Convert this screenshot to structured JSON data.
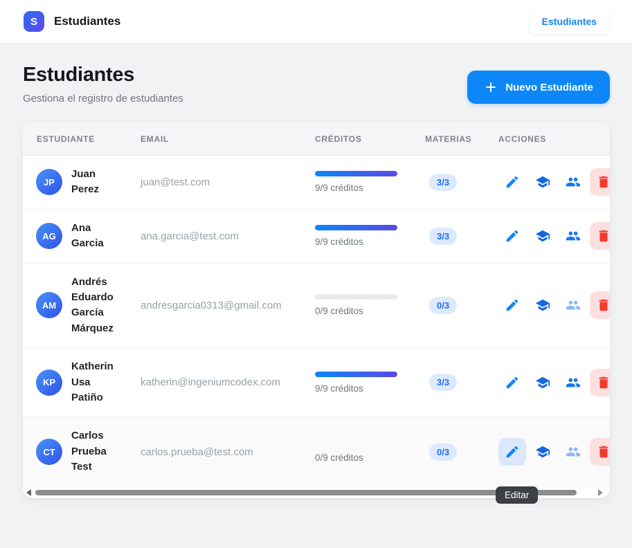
{
  "navbar": {
    "logo_letter": "S",
    "app_title": "Estudiantes",
    "nav_link": "Estudiantes"
  },
  "page_header": {
    "title": "Estudiantes",
    "subtitle": "Gestiona el registro de estudiantes",
    "new_student_button": "Nuevo Estudiante"
  },
  "table": {
    "headers": {
      "student": "ESTUDIANTE",
      "email": "EMAIL",
      "credits": "CRÉDITOS",
      "subjects": "MATERIAS",
      "actions": "ACCIONES"
    },
    "rows": [
      {
        "initials": "JP",
        "name": "Juan Perez",
        "email": "juan@test.com",
        "progress_percent": 100,
        "credits_label": "9/9 créditos",
        "subjects_badge": "3/3",
        "people_disabled": false,
        "edit_active": false,
        "hovered": false
      },
      {
        "initials": "AG",
        "name": "Ana Garcia",
        "email": "ana.garcia@test.com",
        "progress_percent": 100,
        "credits_label": "9/9 créditos",
        "subjects_badge": "3/3",
        "people_disabled": false,
        "edit_active": false,
        "hovered": false
      },
      {
        "initials": "AM",
        "name": "Andrés Eduardo García Márquez",
        "email": "andresgarcia0313@gmail.com",
        "progress_percent": 0,
        "credits_label": "0/9 créditos",
        "subjects_badge": "0/3",
        "people_disabled": true,
        "edit_active": false,
        "hovered": false
      },
      {
        "initials": "KP",
        "name": "Katherin Usa Patiño",
        "email": "katherin@ingeniumcodex.com",
        "progress_percent": 100,
        "credits_label": "9/9 créditos",
        "subjects_badge": "3/3",
        "people_disabled": false,
        "edit_active": false,
        "hovered": false
      },
      {
        "initials": "CT",
        "name": "Carlos Prueba Test",
        "email": "carlos.prueba@test.com",
        "progress_percent": 0,
        "credits_label": "0/9 créditos",
        "subjects_badge": "0/3",
        "people_disabled": true,
        "edit_active": true,
        "hovered": true
      }
    ]
  },
  "tooltip": {
    "text": "Editar"
  },
  "colors": {
    "accent_blue": "#0d86f8",
    "progress_gradient_start": "#0b86f8",
    "progress_gradient_end": "#5a49e6",
    "badge_bg": "#ddeafd",
    "badge_text": "#1d6ff2",
    "danger_red": "#f23a2e",
    "danger_bg": "#fcdfdf",
    "tooltip_bg": "#3d4043",
    "page_bg": "#f1f2f4"
  }
}
